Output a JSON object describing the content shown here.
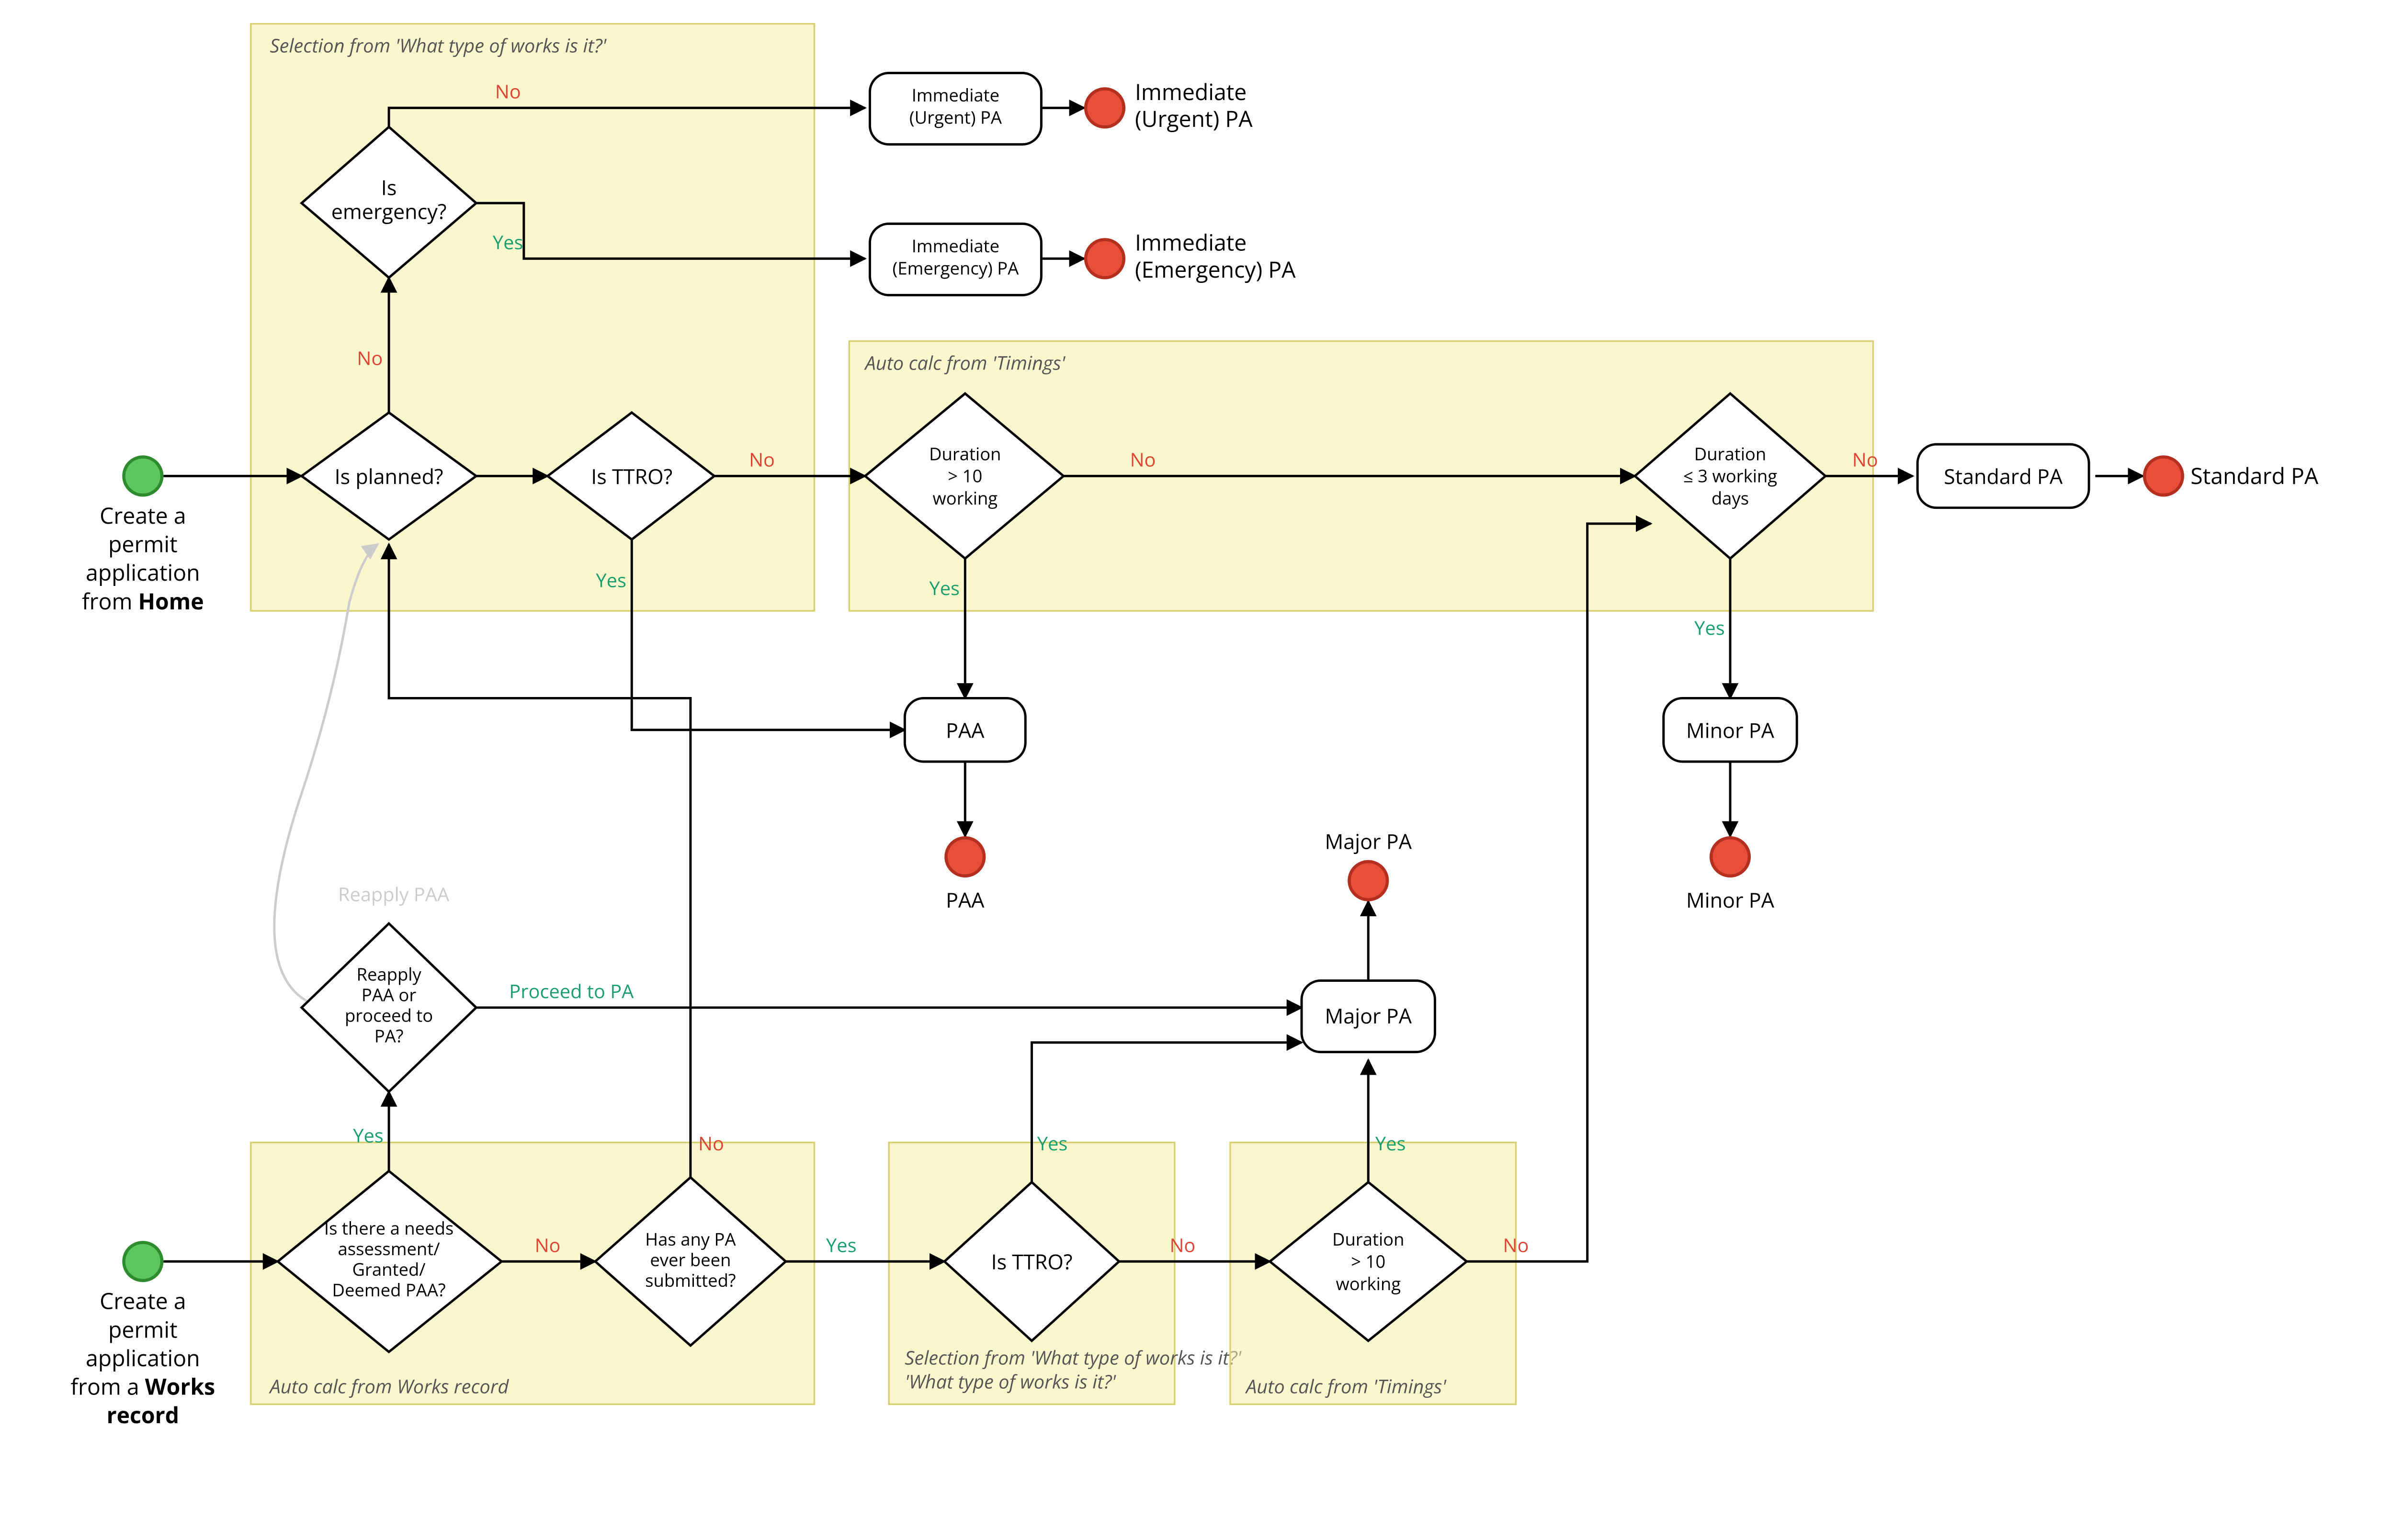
{
  "groups": {
    "g1": "Selection from 'What type of works is it?'",
    "g2": "Auto calc from 'Timings'",
    "g3": "Auto calc from Works record",
    "g4": "Selection from 'What type of works is it?'",
    "g5": "Auto calc from 'Timings'"
  },
  "starts": {
    "s1a": "Create a",
    "s1b": "permit",
    "s1c": "application",
    "s1d": "from ",
    "s1e": "Home",
    "s2a": "Create a",
    "s2b": "permit",
    "s2c": "application",
    "s2d": "from a ",
    "s2e": "Works",
    "s2f": "record"
  },
  "nodes": {
    "emergency1": "Is",
    "emergency2": "emergency?",
    "planned": "Is planned?",
    "ttro1": "Is TTRO?",
    "dur10a1": "Duration",
    "dur10a2": "> 10",
    "dur10a3": "working",
    "dur3a1": "Duration",
    "dur3a2": "≤ 3 working",
    "dur3a3": "days",
    "paa": "PAA",
    "minor": "Minor PA",
    "standard": "Standard PA",
    "urgent1": "Immediate",
    "urgent2": "(Urgent) PA",
    "emerg1": "Immediate",
    "emerg2": "(Emergency) PA",
    "majorpa": "Major PA",
    "reapply1": "Reapply",
    "reapply2": "PAA or",
    "reapply3": "proceed to",
    "reapply4": "PA?",
    "needs1": "Is there a needs",
    "needs2": "assessment/",
    "needs3": "Granted/",
    "needs4": "Deemed PAA?",
    "anypa1": "Has any PA",
    "anypa2": "ever been",
    "anypa3": "submitted?",
    "ttro2": "Is TTRO?",
    "dur10b1": "Duration",
    "dur10b2": "> 10",
    "dur10b3": "working"
  },
  "ends": {
    "urgent1": "Immediate",
    "urgent2": "(Urgent) PA",
    "emerg1": "Immediate",
    "emerg2": "(Emergency) PA",
    "standard": "Standard PA",
    "paa": "PAA",
    "minor": "Minor PA",
    "major": "Major PA"
  },
  "edges": {
    "no": "No",
    "yes": "Yes",
    "proceed": "Proceed to PA",
    "reapply": "Reapply PAA"
  },
  "chart_data": {
    "type": "flowchart",
    "starts": [
      {
        "id": "start_home",
        "label": "Create a permit application from Home"
      },
      {
        "id": "start_works",
        "label": "Create a permit application from a Works record"
      }
    ],
    "nodes": [
      {
        "id": "is_planned",
        "type": "decision",
        "label": "Is planned?",
        "group": "g1"
      },
      {
        "id": "is_emergency",
        "type": "decision",
        "label": "Is emergency?",
        "group": "g1"
      },
      {
        "id": "is_ttro_top",
        "type": "decision",
        "label": "Is TTRO?",
        "group": "g1"
      },
      {
        "id": "dur_gt10_top",
        "type": "decision",
        "label": "Duration > 10 working",
        "group": "g2"
      },
      {
        "id": "dur_le3",
        "type": "decision",
        "label": "Duration ≤ 3 working days",
        "group": "g2"
      },
      {
        "id": "proc_paa",
        "type": "process",
        "label": "PAA"
      },
      {
        "id": "proc_minor",
        "type": "process",
        "label": "Minor PA"
      },
      {
        "id": "proc_standard",
        "type": "process",
        "label": "Standard PA"
      },
      {
        "id": "proc_urgent",
        "type": "process",
        "label": "Immediate (Urgent) PA"
      },
      {
        "id": "proc_emerg",
        "type": "process",
        "label": "Immediate (Emergency) PA"
      },
      {
        "id": "proc_major",
        "type": "process",
        "label": "Major PA"
      },
      {
        "id": "reapply_or_proceed",
        "type": "decision",
        "label": "Reapply PAA or proceed to PA?"
      },
      {
        "id": "needs_paa",
        "type": "decision",
        "label": "Is there a needs assessment/ Granted/ Deemed PAA?",
        "group": "g3"
      },
      {
        "id": "any_pa_submitted",
        "type": "decision",
        "label": "Has any PA ever been submitted?",
        "group": "g3"
      },
      {
        "id": "is_ttro_bot",
        "type": "decision",
        "label": "Is TTRO?",
        "group": "g4"
      },
      {
        "id": "dur_gt10_bot",
        "type": "decision",
        "label": "Duration > 10 working",
        "group": "g5"
      }
    ],
    "ends": [
      {
        "id": "end_urgent",
        "label": "Immediate (Urgent) PA"
      },
      {
        "id": "end_emerg",
        "label": "Immediate (Emergency) PA"
      },
      {
        "id": "end_standard",
        "label": "Standard PA"
      },
      {
        "id": "end_paa",
        "label": "PAA"
      },
      {
        "id": "end_minor",
        "label": "Minor PA"
      },
      {
        "id": "end_major",
        "label": "Major PA"
      }
    ],
    "groups": {
      "g1": "Selection from 'What type of works is it?'",
      "g2": "Auto calc from 'Timings'",
      "g3": "Auto calc from Works record",
      "g4": "Selection from 'What type of works is it?'",
      "g5": "Auto calc from 'Timings'"
    },
    "edges": [
      {
        "from": "start_home",
        "to": "is_planned"
      },
      {
        "from": "is_planned",
        "to": "is_emergency",
        "label": "No"
      },
      {
        "from": "is_planned",
        "to": "is_ttro_top",
        "label": "(Yes)"
      },
      {
        "from": "is_emergency",
        "to": "proc_urgent",
        "label": "No"
      },
      {
        "from": "is_emergency",
        "to": "proc_emerg",
        "label": "Yes"
      },
      {
        "from": "proc_urgent",
        "to": "end_urgent"
      },
      {
        "from": "proc_emerg",
        "to": "end_emerg"
      },
      {
        "from": "is_ttro_top",
        "to": "dur_gt10_top",
        "label": "No"
      },
      {
        "from": "is_ttro_top",
        "to": "proc_paa",
        "label": "Yes"
      },
      {
        "from": "dur_gt10_top",
        "to": "proc_paa",
        "label": "Yes"
      },
      {
        "from": "dur_gt10_top",
        "to": "dur_le3",
        "label": "No"
      },
      {
        "from": "dur_le3",
        "to": "proc_minor",
        "label": "Yes"
      },
      {
        "from": "dur_le3",
        "to": "proc_standard",
        "label": "No"
      },
      {
        "from": "proc_paa",
        "to": "end_paa"
      },
      {
        "from": "proc_minor",
        "to": "end_minor"
      },
      {
        "from": "proc_standard",
        "to": "end_standard"
      },
      {
        "from": "start_works",
        "to": "needs_paa"
      },
      {
        "from": "needs_paa",
        "to": "reapply_or_proceed",
        "label": "Yes"
      },
      {
        "from": "needs_paa",
        "to": "any_pa_submitted",
        "label": "No"
      },
      {
        "from": "reapply_or_proceed",
        "to": "is_planned",
        "label": "Reapply PAA",
        "faded": true
      },
      {
        "from": "reapply_or_proceed",
        "to": "proc_major",
        "label": "Proceed to PA"
      },
      {
        "from": "any_pa_submitted",
        "to": "is_planned",
        "label": "No"
      },
      {
        "from": "any_pa_submitted",
        "to": "is_ttro_bot",
        "label": "Yes"
      },
      {
        "from": "is_ttro_bot",
        "to": "proc_major",
        "label": "Yes"
      },
      {
        "from": "is_ttro_bot",
        "to": "dur_gt10_bot",
        "label": "No"
      },
      {
        "from": "dur_gt10_bot",
        "to": "proc_major",
        "label": "Yes"
      },
      {
        "from": "dur_gt10_bot",
        "to": "dur_le3",
        "label": "No"
      },
      {
        "from": "proc_major",
        "to": "end_major"
      }
    ]
  }
}
